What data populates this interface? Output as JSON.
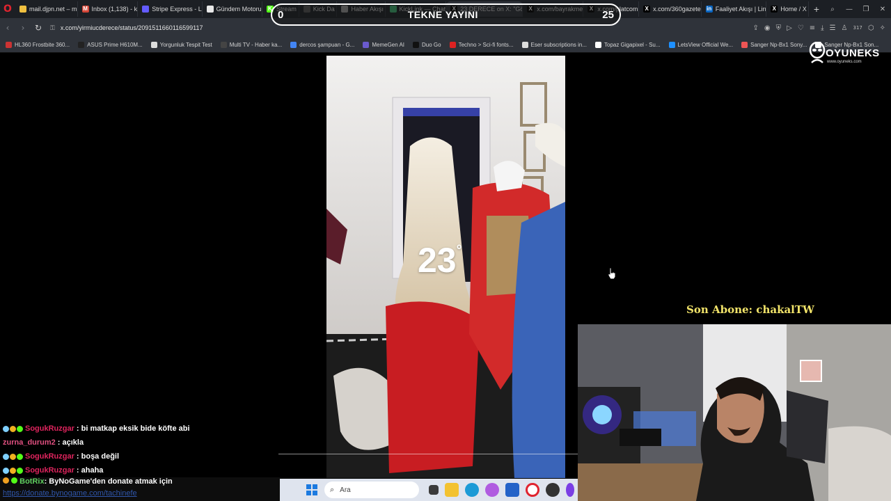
{
  "browser": {
    "tabs": [
      {
        "label": "mail.djpn.net – m",
        "fav": "#f0c040"
      },
      {
        "label": "Inbox (1,138) - k",
        "fav": "#d44638",
        "glyph": "M"
      },
      {
        "label": "Stripe Express - L",
        "fav": "#635bff"
      },
      {
        "label": "Gündem Motoru",
        "fav": "#e8e8e8"
      },
      {
        "label": "Stream",
        "fav": "#53fc18",
        "glyph": "K"
      },
      {
        "label": "Kick Da",
        "fav": "#555"
      },
      {
        "label": "Haber Akışı",
        "fav": "#999"
      },
      {
        "label": "KickLink — Chat",
        "fav": "#3cb371"
      },
      {
        "label": "23 DERECE on X: \"Görgü",
        "fav": "#000",
        "glyph": "X",
        "active": true
      },
      {
        "label": "x.com/bayrakme",
        "fav": "#000",
        "glyph": "X"
      },
      {
        "label": "x.com/platcom",
        "fav": "#000",
        "glyph": "X"
      },
      {
        "label": "x.com/360gazete",
        "fav": "#000",
        "glyph": "X"
      },
      {
        "label": "Faaliyet Akışı | Lin",
        "fav": "#0a66c2",
        "glyph": "in"
      },
      {
        "label": "Home / X",
        "fav": "#000",
        "glyph": "X"
      }
    ],
    "url": "x.com/yirmiucderece/status/2091511660116599117",
    "profile_badge": "317",
    "bookmarks": [
      {
        "label": "HL360 Frostbite 360...",
        "color": "#c33"
      },
      {
        "label": "ASUS Prime H610M...",
        "color": "#222"
      },
      {
        "label": "Yorgunluk Tespit Test",
        "color": "#ddd"
      },
      {
        "label": "Multi TV - Haber ka...",
        "color": "#444"
      },
      {
        "label": "dercos şampuan - G...",
        "color": "#4285f4"
      },
      {
        "label": "MemeGen AI",
        "color": "#6a5acd"
      },
      {
        "label": "Duo Go",
        "color": "#111"
      },
      {
        "label": "Techno > Sci-fi fonts...",
        "color": "#d22"
      },
      {
        "label": "Eser subscriptions in...",
        "color": "#ddd"
      },
      {
        "label": "Topaz Gigapixel - Su...",
        "color": "#fff"
      },
      {
        "label": "LetsView Official We...",
        "color": "#1e90ff"
      },
      {
        "label": "Sanger Np-Bx1 Sony...",
        "color": "#e55"
      },
      {
        "label": "Sanger Np-Bx1 Son...",
        "color": "#fff"
      }
    ]
  },
  "overlay": {
    "score_left": "0",
    "title": "TEKNE YAYINI",
    "score_right": "25",
    "logo_brand": "OYUNEKS",
    "logo_domain": "www.oyuneks.com",
    "subscriber": "Son Abone: chakalTW"
  },
  "video": {
    "watermark": "23"
  },
  "chat": {
    "messages": [
      {
        "user": "SogukRuzgar",
        "user_color": "#e0245e",
        "text": ": bi matkap eksik bide köfte abi",
        "badges": true
      },
      {
        "user": "zurna_durum2",
        "user_color": "#e05080",
        "text": ": açıkla",
        "badges": false
      },
      {
        "user": "SogukRuzgar",
        "user_color": "#e0245e",
        "text": ": boşa değil",
        "badges": true
      },
      {
        "user": "SogukRuzgar",
        "user_color": "#e0245e",
        "text": ": ahaha",
        "badges": true
      }
    ],
    "bot": {
      "user": "BotRix",
      "text": ": ByNoGame'den donate atmak için",
      "link": "https://donate.bynogame.com/tachinefe"
    }
  },
  "taskbar": {
    "search_placeholder": "Ara"
  }
}
